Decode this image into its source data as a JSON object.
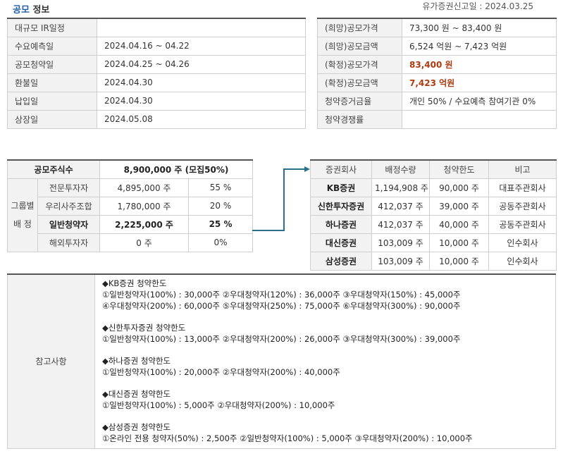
{
  "header": {
    "title_accent": "공모",
    "title_rest": "정보",
    "filing_date": "유가증권신고일 : 2024.03.25"
  },
  "schedule": [
    {
      "label": "대규모 IR일정",
      "value": ""
    },
    {
      "label": "수요예측일",
      "value": "2024.04.16 ~ 04.22"
    },
    {
      "label": "공모청약일",
      "value": "2024.04.25 ~ 04.26"
    },
    {
      "label": "환불일",
      "value": "2024.04.30"
    },
    {
      "label": "납입일",
      "value": "2024.04.30"
    },
    {
      "label": "상장일",
      "value": "2024.05.08"
    }
  ],
  "price": [
    {
      "label": "(희망)공모가격",
      "value": "73,300 원 ~ 83,400 원",
      "highlight": false
    },
    {
      "label": "(희망)공모금액",
      "value": "6,524 억원   ~ 7,423 억원",
      "highlight": false
    },
    {
      "label": "(확정)공모가격",
      "value": "83,400 원",
      "highlight": true
    },
    {
      "label": "(확정)공모금액",
      "value": "7,423 억원",
      "highlight": true
    },
    {
      "label": "청약증거금율",
      "value": "개인 50% / 수요예측 참여기관 0%",
      "highlight": false
    },
    {
      "label": "청약경쟁률",
      "value": "",
      "highlight": false
    }
  ],
  "shares": {
    "total_label": "공모주식수",
    "total_value": "8,900,000 주 (모집50%)",
    "group_label_1": "그룹별",
    "group_label_2": "배 정",
    "rows": [
      {
        "label": "전문투자자",
        "shares": "4,895,000 주",
        "pct": "55 %"
      },
      {
        "label": "우리사주조합",
        "shares": "1,780,000 주",
        "pct": "20 %"
      },
      {
        "label": "일반청약자",
        "shares": "2,225,000 주",
        "pct": "25 %"
      },
      {
        "label": "해외투자자",
        "shares": "0 주",
        "pct": "0%"
      }
    ]
  },
  "brokers": {
    "headers": [
      "증권회사",
      "배정수량",
      "청약한도",
      "비고"
    ],
    "rows": [
      {
        "name": "KB증권",
        "alloc": "1,194,908 주",
        "limit": "90,000 주",
        "note": "대표주관회사"
      },
      {
        "name": "신한투자증권",
        "alloc": "412,037 주",
        "limit": "39,000 주",
        "note": "공동주관회사"
      },
      {
        "name": "하나증권",
        "alloc": "412,037 주",
        "limit": "40,000 주",
        "note": "공동주관회사"
      },
      {
        "name": "대신증권",
        "alloc": "103,009 주",
        "limit": "10,000 주",
        "note": "인수회사"
      },
      {
        "name": "삼성증권",
        "alloc": "103,009 주",
        "limit": "10,000 주",
        "note": "인수회사"
      }
    ]
  },
  "notes": {
    "label": "참고사항",
    "groups": [
      {
        "title": "◆KB증권 청약한도",
        "lines": [
          "①일반청약자(100%) : 30,000주 ②우대청약자(120%) : 36,000주 ③우대청약자(150%) : 45,000주",
          "④우대청약자(200%) : 60,000주 ⑤우대청약자(250%) : 75,000주 ⑥우대청약자(300%) : 90,000주"
        ]
      },
      {
        "title": "◆신한투자증권 청약한도",
        "lines": [
          "①일반청약자(100%) : 13,000주 ②우대청약자(200%) : 26,000주 ③우대청약자(300%) : 39,000주"
        ]
      },
      {
        "title": "◆하나증권 청약한도",
        "lines": [
          "①일반청약자(100%) : 20,000주 ②우대청약자(200%) : 40,000주"
        ]
      },
      {
        "title": "◆대신증권 청약한도",
        "lines": [
          "①일반청약자(100%) : 5,000주 ②우대청약자(200%) : 10,000주"
        ]
      },
      {
        "title": "◆삼성증권 청약한도",
        "lines": [
          "①온라인 전용 청약자(50%) : 2,500주 ②일반청약자(100%) : 5,000주 ③우대청약자(200%) : 10,000주"
        ]
      }
    ]
  },
  "colors": {
    "accent": "#1f5fa8",
    "highlight": "#b03a10",
    "connector": "#2b6f8a"
  }
}
